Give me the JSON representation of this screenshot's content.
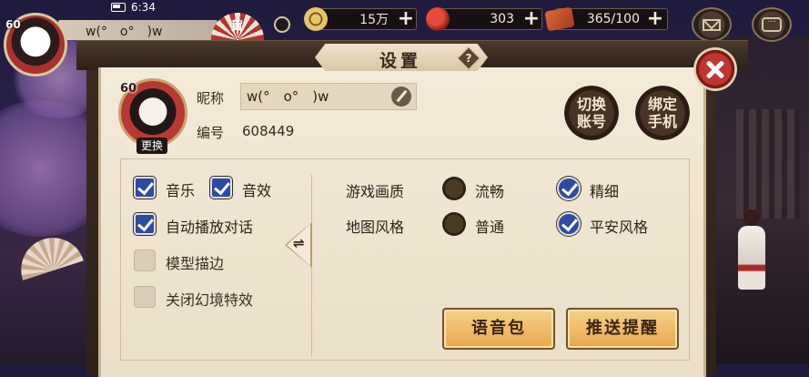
{
  "status_bar": {
    "time": "6:34"
  },
  "hud": {
    "level": "60",
    "player_name": "w(°　o°　)w",
    "event_label": "賀",
    "resources": [
      {
        "icon": "coin-icon",
        "value": "15万"
      },
      {
        "icon": "magatama-icon",
        "value": "303"
      },
      {
        "icon": "ticket-icon",
        "value": "365/100"
      }
    ]
  },
  "dialog": {
    "title": "设置",
    "help_symbol": "?",
    "profile": {
      "level": "60",
      "change_avatar_label": "更换",
      "nickname_label": "昵称",
      "nickname_value": "w(°　o°　)w",
      "id_label": "编号",
      "id_value": "608449"
    },
    "switch_account_label": "切换账号",
    "bind_phone_label": "绑定手机",
    "left_options": [
      {
        "label": "音乐",
        "checked": true
      },
      {
        "label": "音效",
        "checked": true
      },
      {
        "label": "自动播放对话",
        "checked": true
      },
      {
        "label": "模型描边",
        "checked": false
      },
      {
        "label": "关闭幻境特效",
        "checked": false
      }
    ],
    "swap_symbol": "⇌",
    "quality": {
      "label": "游戏画质",
      "options": [
        {
          "label": "流畅",
          "selected": false
        },
        {
          "label": "精细",
          "selected": true
        }
      ]
    },
    "map_style": {
      "label": "地图风格",
      "options": [
        {
          "label": "普通",
          "selected": false
        },
        {
          "label": "平安风格",
          "selected": true
        }
      ]
    },
    "voice_pack_label": "语音包",
    "push_reminder_label": "推送提醒"
  },
  "colors": {
    "accent": "#2f4aa5",
    "close": "#c2352f",
    "button": "#e9a74d"
  }
}
